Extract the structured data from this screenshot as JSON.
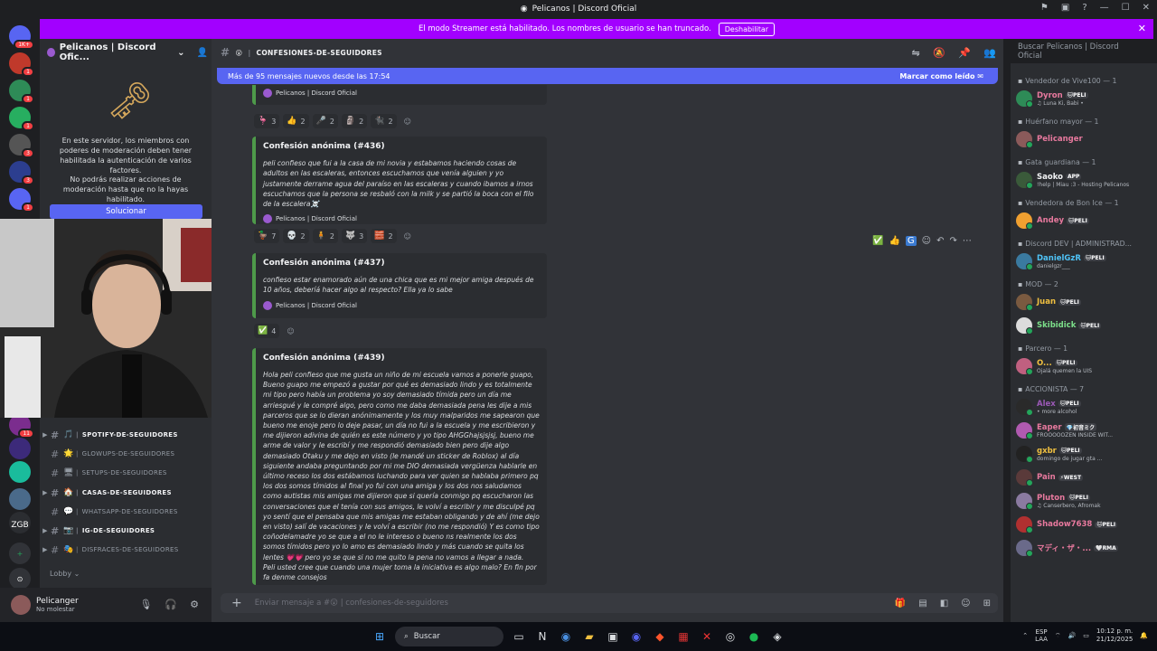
{
  "window": {
    "title": "Pelicanos | Discord Oficial"
  },
  "streamer_bar": {
    "text": "El modo Streamer está habilitado. Los nombres de usuario se han truncado.",
    "button": "Deshabilitar"
  },
  "guilds": [
    {
      "badge": "1K+",
      "color": "#5865f2"
    },
    {
      "badge": "1",
      "color": "#c0392b"
    },
    {
      "badge": "1",
      "color": "#2e8b57"
    },
    {
      "badge": "1",
      "color": "#27ae60"
    },
    {
      "badge": "3",
      "color": "#555"
    },
    {
      "badge": "3",
      "color": "#2c3e8f"
    },
    {
      "badge": "1",
      "color": "#5865f2"
    },
    {
      "badge": "11",
      "color": "#7b2d8e"
    },
    {
      "badge": "",
      "color": "#3c2a7a"
    },
    {
      "badge": "",
      "color": "#1abc9c"
    },
    {
      "badge": "",
      "color": "#4a6a8a"
    },
    {
      "badge": "",
      "color": "#2b2d31"
    }
  ],
  "guild_text_zgb": "ZGB",
  "server": {
    "name": "Pelicanos | Discord Ofic..."
  },
  "mfa": {
    "text1": "En este servidor, los miembros con poderes de moderación deben tener habilitada la autenticación de varios factores.",
    "text2": "No podrás realizar acciones de moderación hasta que no la hayas habilitado.",
    "button": "Solucionar"
  },
  "channels": [
    {
      "emoji": "🎵",
      "name": "spotify-de-seguidores",
      "bold": true,
      "arrow": "▶"
    },
    {
      "emoji": "🌟",
      "name": "glowups-de-seguidores",
      "bold": false,
      "arrow": ""
    },
    {
      "emoji": "🖥",
      "name": "setups-de-seguidores",
      "bold": false,
      "arrow": ""
    },
    {
      "emoji": "🏠",
      "name": "casas-de-seguidores",
      "bold": true,
      "arrow": "▶"
    },
    {
      "emoji": "💬",
      "name": "whatsapp-de-seguidores",
      "bold": false,
      "arrow": ""
    },
    {
      "emoji": "📷",
      "name": "ig-de-seguidores",
      "bold": true,
      "arrow": "▶"
    },
    {
      "emoji": "🎭",
      "name": "disfraces-de-seguidores",
      "bold": false,
      "arrow": "▶"
    }
  ],
  "lobby": "Lobby",
  "user": {
    "name": "Pelicanger",
    "status": "No molestar"
  },
  "channel_header": {
    "emoji": "😮",
    "name": "confesiones-de-seguidores"
  },
  "search_placeholder": "Buscar Pelicanos | Discord Oficial",
  "new_messages": {
    "text": "Más de 95 mensajes nuevos desde las 17:54",
    "mark": "Marcar como leído"
  },
  "messages": [
    {
      "title": "",
      "footer": "Pelicanos | Discord Oficial",
      "reactions": [
        {
          "e": "🦩",
          "n": "3"
        },
        {
          "e": "👍",
          "n": "2"
        },
        {
          "e": "🎤",
          "n": "2"
        },
        {
          "e": "🗿",
          "n": "2"
        },
        {
          "e": "🐈‍⬛",
          "n": "2"
        }
      ]
    },
    {
      "title": "Confesión anónima (#436)",
      "desc": "peli confieso que fui a la casa de mi novia y estabamos haciendo cosas de adultos en las escaleras, entonces escuchamos que venía alguien y yo justamente derrame agua del paraíso en las escaleras y cuando ibamos a irnos escuchamos que la persona se resbaló con la milk y se partió la boca con el filo de la escalera☠️",
      "footer": "Pelicanos | Discord Oficial",
      "reactions": [
        {
          "e": "🦆",
          "n": "7"
        },
        {
          "e": "💀",
          "n": "2"
        },
        {
          "e": "🧍",
          "n": "2"
        },
        {
          "e": "🐺",
          "n": "3"
        },
        {
          "e": "🧱",
          "n": "2"
        }
      ]
    },
    {
      "title": "Confesión anónima (#437)",
      "desc": "confieso estar enamorado aún de una chica que es mi mejor amiga después de 10 años, deberíá hacer algo al respecto? Ella ya lo sabe",
      "footer": "Pelicanos | Discord Oficial",
      "reactions": [
        {
          "e": "✅",
          "n": "4"
        }
      ]
    },
    {
      "title": "Confesión anónima (#439)",
      "desc": "Hola peli confieso que me gusta un niño de mi escuela vamos a ponerle guapo, Bueno guapo me empezó a gustar por qué es demasiado lindo y es totalmente mi tipo pero había un problema yo soy demasiado tímida pero un día me arriesgué y le compré algo, pero como me daba demasiada pena les dije a mis parceros que se lo dieran anónimamente y los muy malparidos me sapearon que bueno me enoje pero lo deje pasar, un día no fui a la escuela y me escribieron y me dijieron adivina de quién es este número y yo tipo AHGGhajsjsjsj, bueno me arme de valor y le escribí y me respondió demasiado bien pero dije algo demasiado Otaku y me dejo en visto (le mandé un sticker de Roblox) al día siguiente andaba preguntando por mi me DIO demasiada vergüenza hablarle en último receso los dos estábamos luchando para ver quien se hablaba primero pq los dos somos tímidos al final yo fui con una amiga y los dos nos saludamos como autistas mis amigas me dijieron que si quería conmigo pq escucharon las conversaciones que el tenía con sus amigos, le volví a escribir y me disculpé pq yo sentí que el pensaba que mis amigas me estaban obligando y de ahí (me dejo en visto) salí de vacaciones y le volví a escribir (no me respondió) Y es como tipo coñodelamadre yo se que a el no le intereso o bueno ns realmente los dos somos tímidos pero yo lo amo es demasiado lindo y más cuando se quita los lentes 💗💗 pero yo se que si no me quito la pena no vamos a llegar a nada.\nPeli usted cree que cuando una mujer toma la iniciativa es algo malo? En fin por fa denme consejos"
    }
  ],
  "composer": {
    "placeholder": "Enviar mensaje a #😮 | confesiones-de-seguidores"
  },
  "member_groups": [
    {
      "label": "Vendedor de Vive100 — 1",
      "members": [
        {
          "name": "Dyron",
          "tag": "🐱PELI",
          "status": "♫ Luna Ki, Babi •",
          "color": "#e8799e",
          "av": "#2e8b57"
        }
      ]
    },
    {
      "label": "Huérfano mayor — 1",
      "members": [
        {
          "name": "Pelicanger",
          "tag": "",
          "status": "",
          "color": "#e8799e",
          "av": "#8b5a5a"
        }
      ]
    },
    {
      "label": "Gata guardiana — 1",
      "members": [
        {
          "name": "Saoko",
          "tag": "APP",
          "status": "!help | Miau :3 - Hosting Pelicanos",
          "color": "#f2f3f5",
          "av": "#3a5a3a"
        }
      ]
    },
    {
      "label": "Vendedora de Bon Ice — 1",
      "members": [
        {
          "name": "Andey",
          "tag": "🐱PELI",
          "status": "",
          "color": "#e8799e",
          "av": "#f0a030"
        }
      ]
    },
    {
      "label": "Discord DEV | ADMINISTRAD...",
      "members": [
        {
          "name": "DanielGzR",
          "tag": "🐱PELI",
          "status": "danielgzr___",
          "color": "#4fc3f7",
          "av": "#3a7aa0"
        }
      ]
    },
    {
      "label": "MOD — 2",
      "members": [
        {
          "name": "Juan",
          "tag": "🐱PELI",
          "status": "",
          "color": "#f0c040",
          "av": "#7a5a40"
        },
        {
          "name": "Skibidick",
          "tag": "🐱PELI",
          "status": "",
          "color": "#7ce08a",
          "av": "#dcdcdc"
        }
      ]
    },
    {
      "label": "Parcero — 1",
      "members": [
        {
          "name": "O...",
          "tag": "🐱PELI",
          "status": "Ojalá quemen la UIS",
          "color": "#f0c040",
          "av": "#c06080"
        }
      ]
    },
    {
      "label": "ACCIONISTA — 7",
      "members": [
        {
          "name": "Alex",
          "tag": "🐱PELI",
          "status": "• more alcohol",
          "color": "#9b59b6",
          "av": "#2a2a2a"
        },
        {
          "name": "Eaper",
          "tag": "💎初音ミク",
          "status": "FROOOOOZEN INSIDE WIT...",
          "color": "#e8799e",
          "av": "#b05ab0"
        },
        {
          "name": "gxbr",
          "tag": "🐱PELI",
          "status": "domingo de jugar gta ...",
          "color": "#f0c040",
          "av": "#222"
        },
        {
          "name": "Pain",
          "tag": "⚡WEST",
          "status": "",
          "color": "#e8799e",
          "av": "#5a3a3a"
        },
        {
          "name": "Pluton",
          "tag": "🐱PELI",
          "status": "♫ Canserbero, Afromak",
          "color": "#e8799e",
          "av": "#8a7aa0"
        },
        {
          "name": "Shadow7638",
          "tag": "🐱PELI",
          "status": "",
          "color": "#e8799e",
          "av": "#b03030"
        },
        {
          "name": "マディ・ザ・...",
          "tag": "🤍RMA",
          "status": "",
          "color": "#e8799e",
          "av": "#6a6a8a"
        }
      ]
    }
  ],
  "taskbar": {
    "search": "Buscar",
    "lang": "ESP",
    "lang2": "LAA",
    "time": "10:12 p. m.",
    "date": "21/12/2025"
  }
}
